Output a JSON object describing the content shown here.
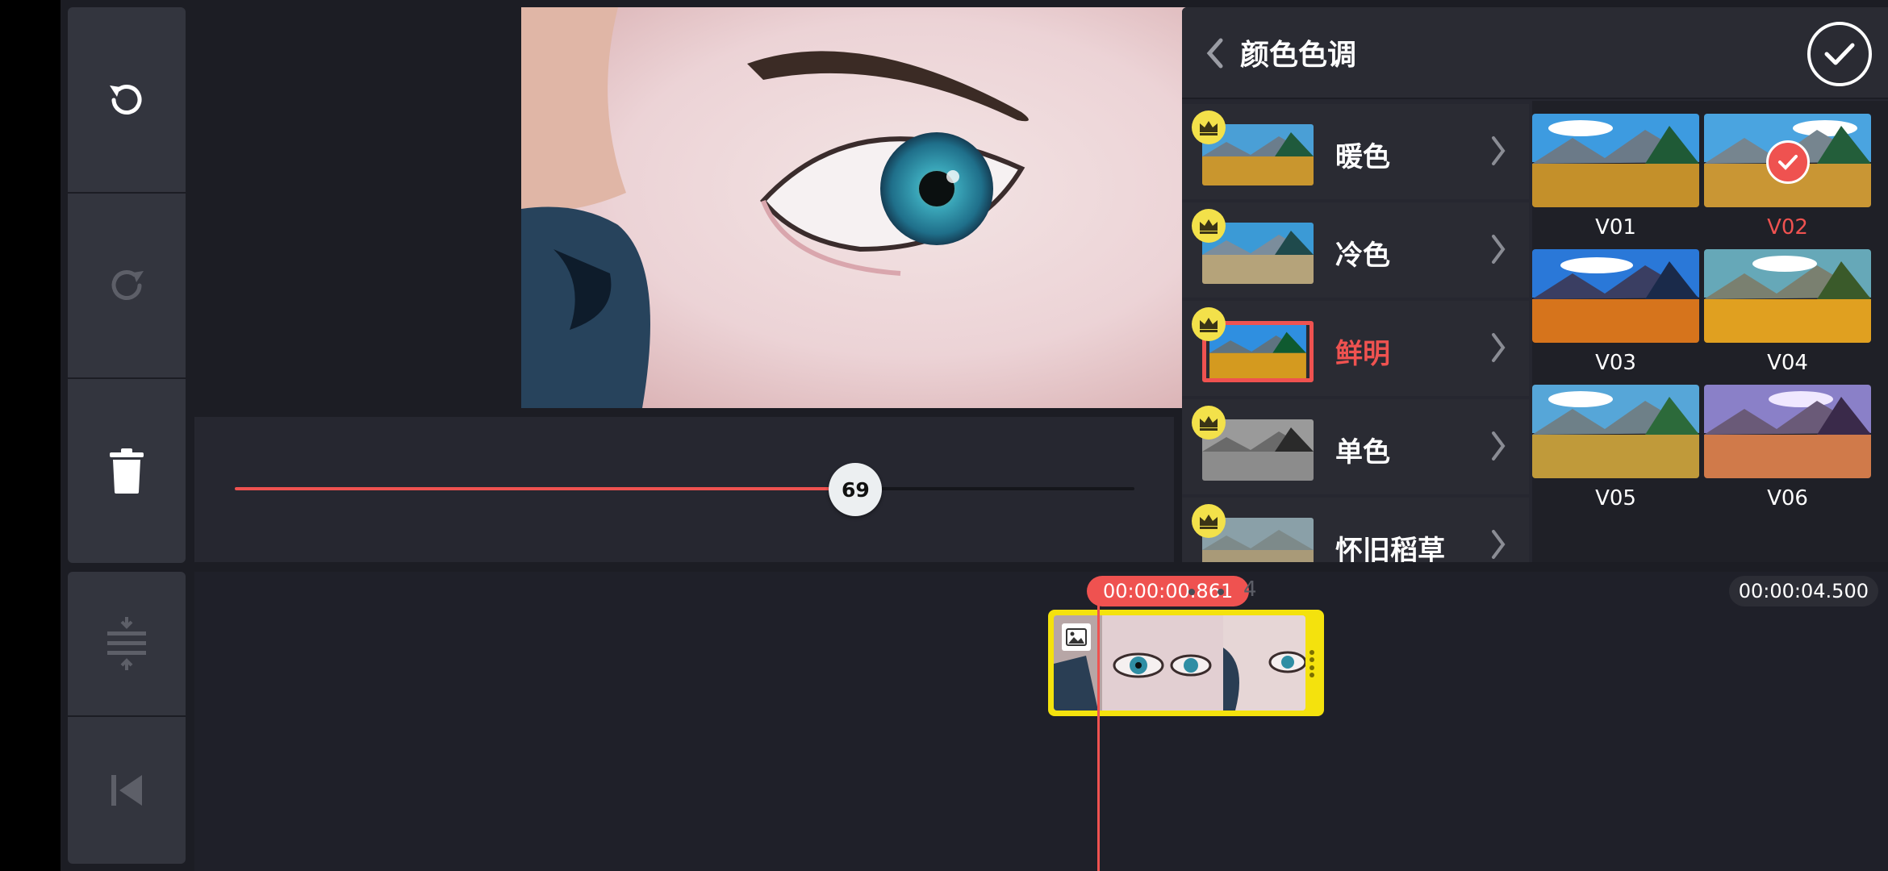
{
  "toolbar": {
    "undo": "undo-icon",
    "redo": "redo-icon",
    "delete": "trash-icon",
    "split": "split-icon",
    "to_start": "skip-start-icon"
  },
  "slider": {
    "value": "69",
    "fraction": 0.69
  },
  "panel": {
    "title": "颜色色调"
  },
  "categories": [
    {
      "label": "暖色",
      "selected": false
    },
    {
      "label": "冷色",
      "selected": false
    },
    {
      "label": "鲜明",
      "selected": true
    },
    {
      "label": "单色",
      "selected": false
    },
    {
      "label": "怀旧稻草",
      "selected": false
    }
  ],
  "presets": [
    {
      "label": "V01",
      "selected": false
    },
    {
      "label": "V02",
      "selected": true
    },
    {
      "label": "V03",
      "selected": false
    },
    {
      "label": "V04",
      "selected": false
    },
    {
      "label": "V05",
      "selected": false
    },
    {
      "label": "V06",
      "selected": false
    }
  ],
  "timeline": {
    "current_time": "00:00:00.861",
    "end_time": "00:00:04.500",
    "tick_label": "4"
  },
  "colors": {
    "accent": "#ef5250",
    "clip_border": "#f4e20d",
    "crown": "#f3e14a"
  }
}
